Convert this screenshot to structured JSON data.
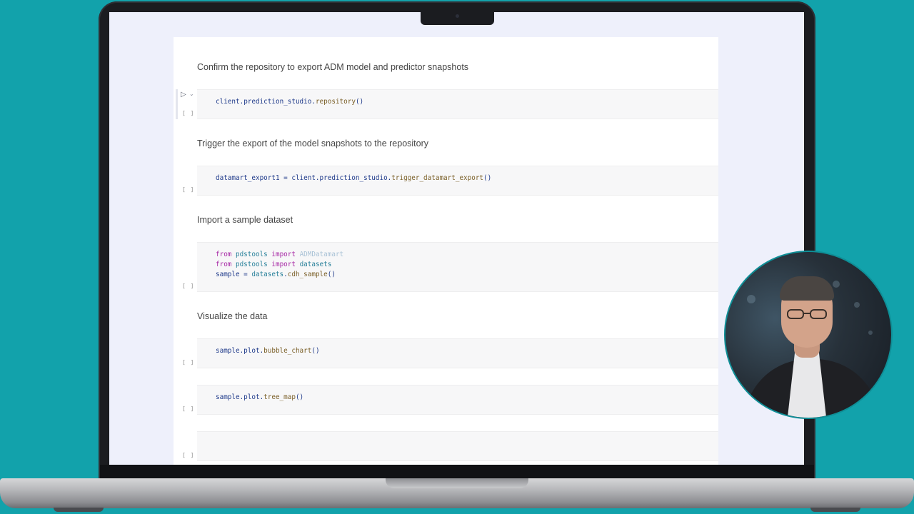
{
  "notebook": {
    "cells": [
      {
        "type": "markdown",
        "text": "Confirm the repository to export ADM model and predictor snapshots"
      },
      {
        "type": "code",
        "exec": "[ ]",
        "lines": [
          {
            "parts": [
              {
                "t": "client",
                "c": "plain"
              },
              {
                "t": ".prediction_studio.",
                "c": "plain"
              },
              {
                "t": "repository",
                "c": "fn"
              },
              {
                "t": "()",
                "c": "plain"
              }
            ]
          }
        ]
      },
      {
        "type": "markdown",
        "text": "Trigger the export of the model snapshots to the repository"
      },
      {
        "type": "code",
        "exec": "[ ]",
        "lines": [
          {
            "parts": [
              {
                "t": "datamart_export1 = client.prediction_studio.",
                "c": "plain"
              },
              {
                "t": "trigger_datamart_export",
                "c": "fn"
              },
              {
                "t": "()",
                "c": "plain"
              }
            ]
          }
        ]
      },
      {
        "type": "markdown",
        "text": "Import a sample dataset"
      },
      {
        "type": "code",
        "exec": "[ ]",
        "lines": [
          {
            "parts": [
              {
                "t": "from",
                "c": "kw"
              },
              {
                "t": " pdstools ",
                "c": "mod"
              },
              {
                "t": "import",
                "c": "kw"
              },
              {
                "t": " ADMDatamart",
                "c": "faded"
              }
            ]
          },
          {
            "parts": [
              {
                "t": "from",
                "c": "kw"
              },
              {
                "t": " pdstools ",
                "c": "mod"
              },
              {
                "t": "import",
                "c": "kw"
              },
              {
                "t": " datasets",
                "c": "mod"
              }
            ]
          },
          {
            "parts": [
              {
                "t": "sample = ",
                "c": "plain"
              },
              {
                "t": "datasets",
                "c": "mod"
              },
              {
                "t": ".",
                "c": "plain"
              },
              {
                "t": "cdh_sample",
                "c": "fn"
              },
              {
                "t": "()",
                "c": "plain"
              }
            ]
          }
        ]
      },
      {
        "type": "markdown",
        "text": "Visualize the data"
      },
      {
        "type": "code",
        "exec": "[ ]",
        "lines": [
          {
            "parts": [
              {
                "t": "sample.plot.",
                "c": "plain"
              },
              {
                "t": "bubble_chart",
                "c": "fn"
              },
              {
                "t": "()",
                "c": "plain"
              }
            ]
          }
        ]
      },
      {
        "type": "code",
        "exec": "[ ]",
        "lines": [
          {
            "parts": [
              {
                "t": "sample.plot.",
                "c": "plain"
              },
              {
                "t": "tree_map",
                "c": "fn"
              },
              {
                "t": "()",
                "c": "plain"
              }
            ]
          }
        ]
      },
      {
        "type": "code",
        "exec": "[ ]",
        "lines": []
      }
    ]
  },
  "icons": {
    "run": "play-icon",
    "collapse": "chevron-down-icon"
  },
  "colors": {
    "background": "#12a2ab",
    "keyword": "#a626a4",
    "function": "#795e26",
    "module": "#267f99"
  }
}
